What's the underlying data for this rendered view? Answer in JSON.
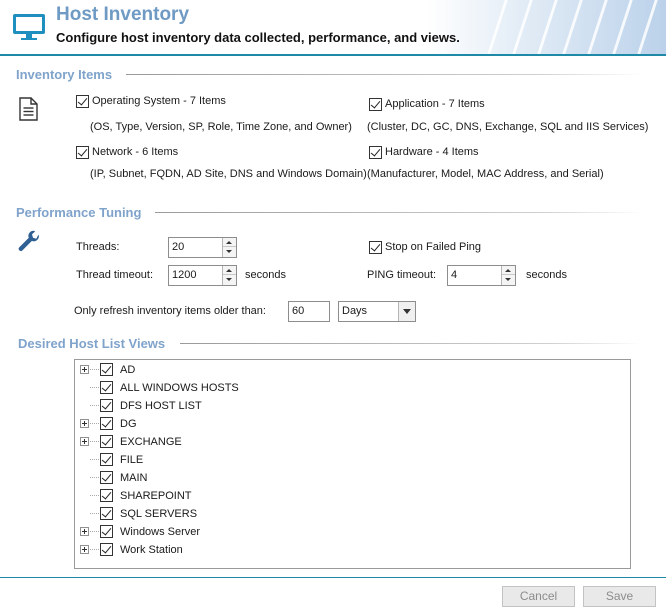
{
  "header": {
    "title": "Host Inventory",
    "subtitle": "Configure host inventory data collected, performance, and views.",
    "icon": "monitor-icon"
  },
  "inventory_items": {
    "title": "Inventory Items",
    "icon": "document-icon",
    "items": [
      {
        "label": "Operating System - 7 Items",
        "checked": true,
        "detail": "(OS, Type, Version, SP, Role, Time Zone, and Owner)"
      },
      {
        "label": "Application - 7 Items",
        "checked": true,
        "detail": "(Cluster, DC, GC, DNS, Exchange, SQL and IIS Services)"
      },
      {
        "label": "Network - 6 Items",
        "checked": true,
        "detail": "(IP, Subnet, FQDN, AD Site, DNS and Windows Domain)"
      },
      {
        "label": "Hardware - 4 Items",
        "checked": true,
        "detail": "(Manufacturer, Model, MAC Address, and Serial)"
      }
    ]
  },
  "performance": {
    "title": "Performance Tuning",
    "icon": "wrench-icon",
    "threads_label": "Threads:",
    "threads_value": "20",
    "thread_timeout_label": "Thread timeout:",
    "thread_timeout_value": "1200",
    "seconds_label": "seconds",
    "stop_on_failed_ping_label": "Stop on Failed Ping",
    "stop_on_failed_ping_checked": true,
    "ping_timeout_label": "PING timeout:",
    "ping_timeout_value": "4",
    "ping_seconds_label": "seconds",
    "refresh_label": "Only refresh inventory items older than:",
    "refresh_value": "60",
    "refresh_unit": "Days"
  },
  "views": {
    "title": "Desired Host List Views",
    "items": [
      {
        "label": "AD",
        "expandable": true,
        "checked": true
      },
      {
        "label": "ALL WINDOWS HOSTS",
        "expandable": false,
        "checked": true
      },
      {
        "label": "DFS HOST LIST",
        "expandable": false,
        "checked": true
      },
      {
        "label": "DG",
        "expandable": true,
        "checked": true
      },
      {
        "label": "EXCHANGE",
        "expandable": true,
        "checked": true
      },
      {
        "label": "FILE",
        "expandable": false,
        "checked": true
      },
      {
        "label": "MAIN",
        "expandable": false,
        "checked": true
      },
      {
        "label": "SHAREPOINT",
        "expandable": false,
        "checked": true
      },
      {
        "label": "SQL SERVERS",
        "expandable": false,
        "checked": true
      },
      {
        "label": "Windows Server",
        "expandable": true,
        "checked": true
      },
      {
        "label": "Work Station",
        "expandable": true,
        "checked": true
      }
    ]
  },
  "footer": {
    "cancel_label": "Cancel",
    "save_label": "Save"
  },
  "colors": {
    "accent": "#1e8aa8",
    "section_title": "#7fa3cb",
    "header_title": "#6e9ac4"
  }
}
